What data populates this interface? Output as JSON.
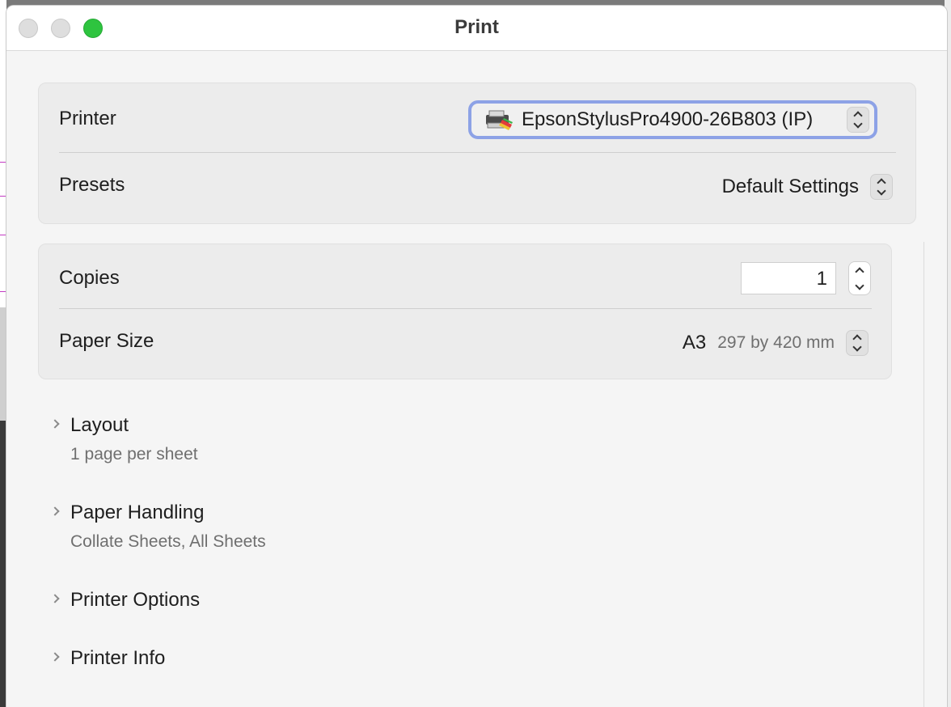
{
  "window": {
    "title": "Print"
  },
  "printer": {
    "label": "Printer",
    "selected": "EpsonStylusPro4900-26B803 (IP)",
    "icon": "printer-icon"
  },
  "presets": {
    "label": "Presets",
    "selected": "Default Settings"
  },
  "copies": {
    "label": "Copies",
    "value": "1"
  },
  "paper_size": {
    "label": "Paper Size",
    "name": "A3",
    "dimensions": "297 by 420 mm"
  },
  "sections": [
    {
      "title": "Layout",
      "subtitle": "1 page per sheet"
    },
    {
      "title": "Paper Handling",
      "subtitle": "Collate Sheets, All Sheets"
    },
    {
      "title": "Printer Options",
      "subtitle": ""
    },
    {
      "title": "Printer Info",
      "subtitle": ""
    }
  ],
  "colors": {
    "close": "#dedede",
    "minimize": "#dedede",
    "maximize": "#2ec43f",
    "focus_ring": "#8da2e6"
  }
}
